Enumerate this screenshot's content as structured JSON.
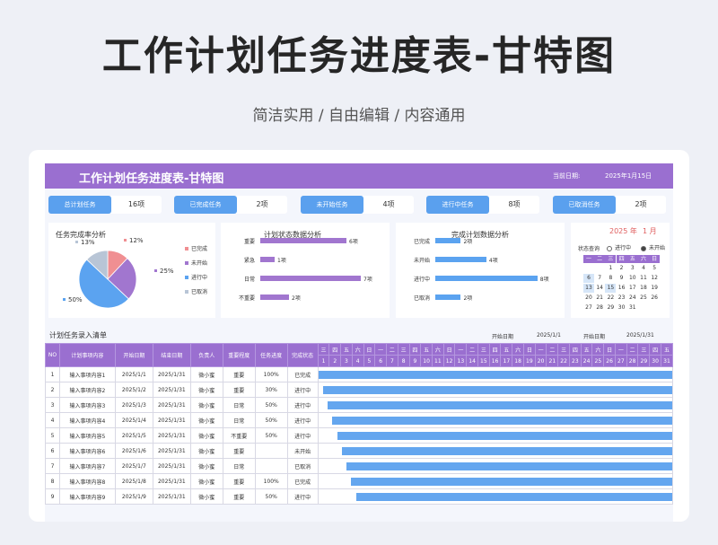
{
  "banner": {
    "title": "工作计划任务进度表-甘特图",
    "subtitle": "简洁实用 / 自由编辑 / 内容通用"
  },
  "sheet": {
    "title": "工作计划任务进度表-甘特图",
    "date_label": "当前日期:",
    "date_value": "2025年1月15日"
  },
  "stats": [
    {
      "label": "总计划任务",
      "value": "16项"
    },
    {
      "label": "已完成任务",
      "value": "2项"
    },
    {
      "label": "未开始任务",
      "value": "4项"
    },
    {
      "label": "进行中任务",
      "value": "8项"
    },
    {
      "label": "已取消任务",
      "value": "2项"
    }
  ],
  "pie_panel": {
    "title": "任务完成率分析"
  },
  "status_panel": {
    "title": "计划状态数据分析"
  },
  "completion_panel": {
    "title": "完成计划数据分析"
  },
  "chart_data": [
    {
      "type": "pie",
      "title": "任务完成率分析",
      "slices": [
        {
          "name": "已完成",
          "percent": 12,
          "label": "12%",
          "color": "#f08f92"
        },
        {
          "name": "未开始",
          "percent": 25,
          "label": "25%",
          "color": "#a176cf"
        },
        {
          "name": "进行中",
          "percent": 50,
          "label": "50%",
          "color": "#5ba3f0"
        },
        {
          "name": "已取消",
          "percent": 13,
          "label": "13%",
          "color": "#b8c5d6"
        }
      ]
    },
    {
      "type": "bar",
      "title": "计划状态数据分析",
      "categories": [
        "重要",
        "紧急",
        "日常",
        "不重要"
      ],
      "values": [
        6,
        1,
        7,
        2
      ],
      "labels": [
        "6项",
        "1项",
        "7项",
        "2项"
      ],
      "color": "#a176cf",
      "xlim": [
        0,
        8
      ]
    },
    {
      "type": "bar",
      "title": "完成计划数据分析",
      "categories": [
        "已完成",
        "未开始",
        "进行中",
        "已取消"
      ],
      "values": [
        2,
        4,
        8,
        2
      ],
      "labels": [
        "2项",
        "4项",
        "8项",
        "2项"
      ],
      "color": "#5ba3f0",
      "xlim": [
        0,
        9
      ]
    }
  ],
  "calendar": {
    "year_label": "2025 年",
    "month_label": "1 月",
    "query_label": "状态查询",
    "opt1": "进行中",
    "opt2": "未开始",
    "weekdays": [
      "一",
      "二",
      "三",
      "四",
      "五",
      "六",
      "日"
    ],
    "rows": [
      [
        "",
        "",
        "1",
        "2",
        "3",
        "4",
        "5"
      ],
      [
        "6",
        "7",
        "8",
        "9",
        "10",
        "11",
        "12"
      ],
      [
        "13",
        "14",
        "15",
        "16",
        "17",
        "18",
        "19"
      ],
      [
        "20",
        "21",
        "22",
        "23",
        "24",
        "25",
        "26"
      ],
      [
        "27",
        "28",
        "29",
        "30",
        "31",
        "",
        ""
      ]
    ],
    "highlight": [
      "6",
      "13",
      "15"
    ]
  },
  "table_section": {
    "title": "计划任务录入清单",
    "start_label": "开始日期",
    "start_value": "2025/1/1",
    "end_label": "开始日期",
    "end_value": "2025/1/31"
  },
  "table": {
    "headers": [
      "NO",
      "计划事项内容",
      "开始日期",
      "结束日期",
      "负责人",
      "重要程度",
      "任务进度",
      "完成状态"
    ],
    "weekday_row": [
      "三",
      "四",
      "五",
      "六",
      "日",
      "一",
      "二",
      "三",
      "四",
      "五",
      "六",
      "日",
      "一",
      "二",
      "三",
      "四",
      "五",
      "六",
      "日",
      "一",
      "二",
      "三",
      "四",
      "五",
      "六",
      "日",
      "一",
      "二",
      "三",
      "四",
      "五"
    ],
    "day_row": [
      "1",
      "2",
      "3",
      "4",
      "5",
      "6",
      "7",
      "8",
      "9",
      "10",
      "11",
      "12",
      "13",
      "14",
      "15",
      "16",
      "17",
      "18",
      "19",
      "20",
      "21",
      "22",
      "23",
      "24",
      "25",
      "26",
      "27",
      "28",
      "29",
      "30",
      "31"
    ],
    "rows": [
      {
        "no": "1",
        "content": "输入事项内容1",
        "start": "2025/1/1",
        "end": "2025/1/31",
        "owner": "微小蜜",
        "level": "重要",
        "progress": "100%",
        "status": "已完成",
        "start_day": 1,
        "end_day": 31
      },
      {
        "no": "2",
        "content": "输入事项内容2",
        "start": "2025/1/2",
        "end": "2025/1/31",
        "owner": "微小蜜",
        "level": "重要",
        "progress": "30%",
        "status": "进行中",
        "start_day": 2,
        "end_day": 31
      },
      {
        "no": "3",
        "content": "输入事项内容3",
        "start": "2025/1/3",
        "end": "2025/1/31",
        "owner": "微小蜜",
        "level": "日常",
        "progress": "50%",
        "status": "进行中",
        "start_day": 3,
        "end_day": 31
      },
      {
        "no": "4",
        "content": "输入事项内容4",
        "start": "2025/1/4",
        "end": "2025/1/31",
        "owner": "微小蜜",
        "level": "日常",
        "progress": "50%",
        "status": "进行中",
        "start_day": 4,
        "end_day": 31
      },
      {
        "no": "5",
        "content": "输入事项内容5",
        "start": "2025/1/5",
        "end": "2025/1/31",
        "owner": "微小蜜",
        "level": "不重要",
        "progress": "50%",
        "status": "进行中",
        "start_day": 5,
        "end_day": 31
      },
      {
        "no": "6",
        "content": "输入事项内容6",
        "start": "2025/1/6",
        "end": "2025/1/31",
        "owner": "微小蜜",
        "level": "重要",
        "progress": "",
        "status": "未开始",
        "start_day": 6,
        "end_day": 31
      },
      {
        "no": "7",
        "content": "输入事项内容7",
        "start": "2025/1/7",
        "end": "2025/1/31",
        "owner": "微小蜜",
        "level": "日常",
        "progress": "",
        "status": "已取消",
        "start_day": 7,
        "end_day": 31
      },
      {
        "no": "8",
        "content": "输入事项内容8",
        "start": "2025/1/8",
        "end": "2025/1/31",
        "owner": "微小蜜",
        "level": "重要",
        "progress": "100%",
        "status": "已完成",
        "start_day": 8,
        "end_day": 31
      },
      {
        "no": "9",
        "content": "输入事项内容9",
        "start": "2025/1/9",
        "end": "2025/1/31",
        "owner": "微小蜜",
        "level": "重要",
        "progress": "50%",
        "status": "进行中",
        "start_day": 9,
        "end_day": 31
      }
    ]
  }
}
